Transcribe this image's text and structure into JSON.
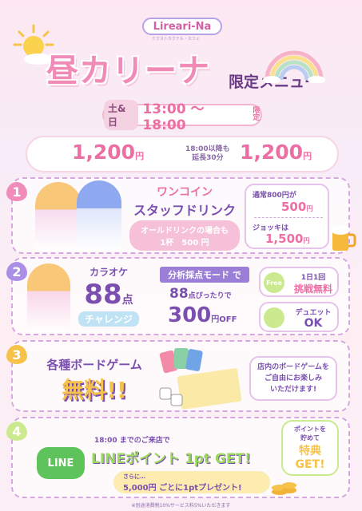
{
  "brand": {
    "logo": "Lireari-Na",
    "logo_sub": "ミクストカクテル・カフェ"
  },
  "title": {
    "main": "昼カリーナ",
    "sub": "限定メニュー"
  },
  "schedule": {
    "days": "土&日",
    "time": "13:00 ～ 18:00",
    "limited": "限定"
  },
  "pricing": {
    "price1": "1,200",
    "yen": "円",
    "extension": [
      "18:00以降も",
      "延長30分"
    ],
    "price2": "1,200"
  },
  "sections": [
    {
      "num": "1",
      "heading": [
        "ワンコイン",
        "スタッフドリンク"
      ],
      "note": [
        "オールドリンクの場合も",
        "1杯　500 円"
      ],
      "box1_label": "通常800円が",
      "box1_value": "500",
      "box1_yen": "円",
      "box2_label": "ジョッキは",
      "box2_value": "1,500",
      "box2_yen": "円"
    },
    {
      "num": "2",
      "heading": [
        "カラオケ",
        "88",
        "点",
        "チャレンジ"
      ],
      "mode": "分析採点モード で",
      "sub": "88",
      "sub2": "点ぴったりで",
      "value": "300",
      "value_unit": "円OFF",
      "free_badge": "Free",
      "free_label": [
        "1日1回",
        "挑戦無料"
      ],
      "duet_label": "デュエット",
      "duet_value": "OK"
    },
    {
      "num": "3",
      "heading": [
        "各種ボードゲーム",
        "無料!!"
      ],
      "note": [
        "店内のボードゲームを",
        "ご自由にお楽しみ",
        "いただけます!"
      ]
    },
    {
      "num": "4",
      "line": "LINE",
      "pre": "18:00 までのご来店で",
      "heading": "LINEポイント 1pt GET!",
      "note": [
        "さらに…",
        "5,000円 ごとに1ptプレゼント!"
      ],
      "reward": [
        "ポイントを",
        "貯めて",
        "特典",
        "GET!"
      ]
    }
  ],
  "footer": "※別途消費税10%サービス料5%いただきます"
}
